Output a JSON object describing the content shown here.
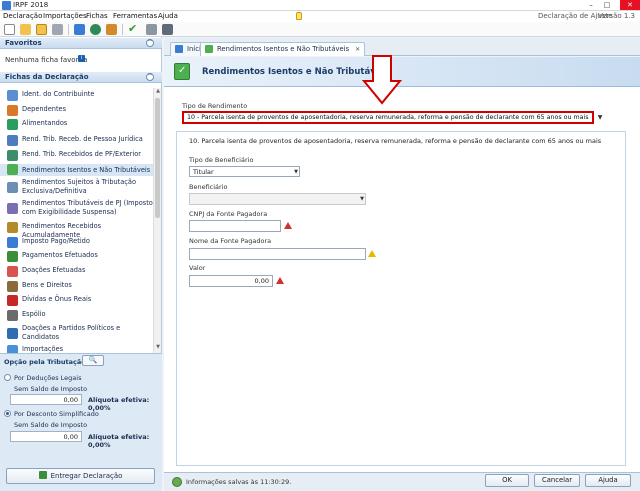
{
  "window": {
    "title": "IRPF 2018",
    "controls": [
      "–",
      "□",
      "✕"
    ]
  },
  "menu": {
    "items": [
      "Declaração",
      "Importações",
      "Fichas",
      "Ferramentas",
      "Ajuda"
    ],
    "declaration_label": "Declaração de Ajuste",
    "version": "Versão 1.3"
  },
  "toolbar": {
    "icons": [
      "new-file-icon",
      "open-folder-icon",
      "save-icon",
      "delete-icon",
      "import-icon",
      "globe-icon",
      "export-icon",
      "check-icon",
      "print-icon",
      "calculator-icon"
    ]
  },
  "sidebar": {
    "favorites_title": "Favoritos",
    "favorites_empty": "Nenhuma ficha favorita",
    "fichas_title": "Fichas da Declaração",
    "items": [
      {
        "label": "Ident. do Contribuinte",
        "icon": "person-card-icon",
        "color": "#5b8fd1"
      },
      {
        "label": "Dependentes",
        "icon": "people-icon",
        "color": "#d97a2b"
      },
      {
        "label": "Alimentandos",
        "icon": "people-icon",
        "color": "#2d9c5f"
      },
      {
        "label": "Rend. Trib. Receb. de Pessoa Jurídica",
        "icon": "building-icon",
        "color": "#4f7cbf"
      },
      {
        "label": "Rend. Trib. Recebidos de PF/Exterior",
        "icon": "globe-icon",
        "color": "#3c8d6a"
      },
      {
        "label": "Rendimentos Isentos e Não Tributáveis",
        "icon": "check-icon",
        "color": "#4caf50"
      },
      {
        "label": "Rendimentos Sujeitos à Tributação Exclusiva/Definitiva",
        "icon": "document-icon",
        "color": "#6d8fb7"
      },
      {
        "label": "Rendimentos Tributáveis de PJ (Imposto com Exigibilidade Suspensa)",
        "icon": "document-icon",
        "color": "#7a6fb0"
      },
      {
        "label": "Rendimentos Recebidos Acumuladamente",
        "icon": "coins-icon",
        "color": "#b58a2a"
      },
      {
        "label": "Imposto Pago/Retido",
        "icon": "coins-icon",
        "color": "#3a7bd5"
      },
      {
        "label": "Pagamentos Efetuados",
        "icon": "money-icon",
        "color": "#3b8f3b"
      },
      {
        "label": "Doações Efetuadas",
        "icon": "gift-icon",
        "color": "#d9534f"
      },
      {
        "label": "Bens e Direitos",
        "icon": "house-icon",
        "color": "#8b6b3d"
      },
      {
        "label": "Dívidas e Ônus Reais",
        "icon": "down-arrow-icon",
        "color": "#c62828"
      },
      {
        "label": "Espólio",
        "icon": "document-icon",
        "color": "#6b6b6b"
      },
      {
        "label": "Doações a Partidos Políticos e Candidatos",
        "icon": "vote-icon",
        "color": "#2f6db3"
      },
      {
        "label": "Importações",
        "icon": "import-icon",
        "color": "#4a90d9"
      }
    ],
    "options": {
      "title": "Opção pela Tributação:",
      "legal": "Por Deduções Legais",
      "legal_sub": "Sem Saldo de Imposto",
      "legal_value": "0,00",
      "legal_aliquota": "Alíquota efetiva: 0,00%",
      "simpl": "Por Desconto Simplificado",
      "simpl_sub": "Sem Saldo de Imposto",
      "simpl_value": "0,00",
      "simpl_aliquota": "Alíquota efetiva: 0,00%",
      "selected": "Por Desconto Simplificado"
    },
    "deliver_button": "Entregar Declaração"
  },
  "tabs": [
    {
      "label": "Início",
      "active": false
    },
    {
      "label": "Rendimentos Isentos e Não Tributáveis",
      "active": true
    }
  ],
  "page": {
    "title": "Rendimentos Isentos e Não Tributáveis",
    "tipo_label": "Tipo de Rendimento",
    "tipo_value": "10 - Parcela isenta de proventos de aposentadoria, reserva remunerada, reforma e pensão de declarante com 65 anos ou mais",
    "section_title": "10. Parcela isenta de proventos de aposentadoria, reserva remunerada, reforma e pensão de declarante com 65 anos ou mais",
    "beneficiario_tipo_label": "Tipo de Beneficiário",
    "beneficiario_tipo_value": "Titular",
    "beneficiario_label": "Beneficiário",
    "beneficiario_value": "",
    "cnpj_label": "CNPJ da Fonte Pagadora",
    "cnpj_value": "",
    "nome_label": "Nome da Fonte Pagadora",
    "nome_value": "",
    "valor_label": "Valor",
    "valor_value": "0,00"
  },
  "status": {
    "message": "Informações salvas às 11:30:29."
  },
  "buttons": {
    "ok": "OK",
    "cancel": "Cancelar",
    "help": "Ajuda"
  }
}
